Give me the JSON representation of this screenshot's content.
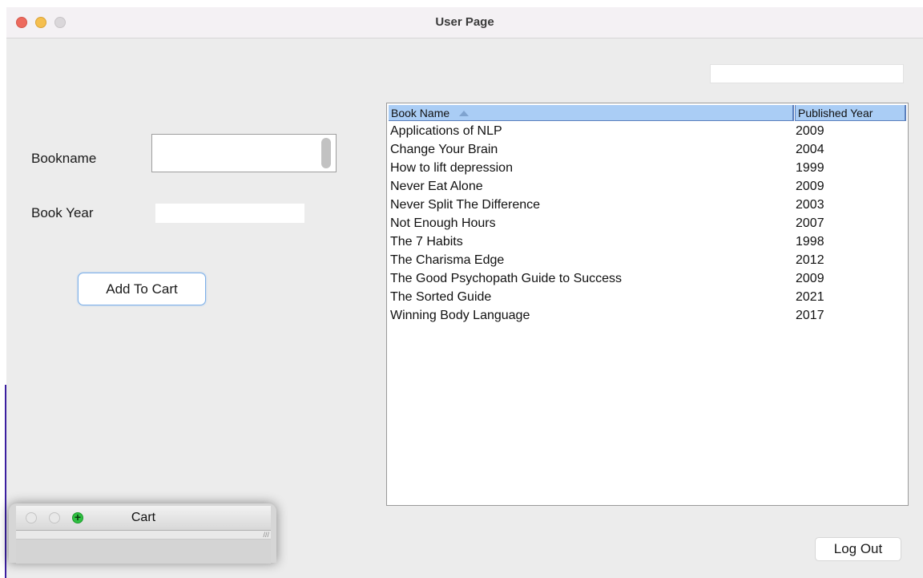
{
  "window": {
    "title": "User Page"
  },
  "form": {
    "bookname_label": "Bookname",
    "bookyear_label": "Book Year",
    "bookname_value": "",
    "bookyear_value": "",
    "add_button_label": "Add To Cart"
  },
  "search": {
    "value": ""
  },
  "table": {
    "columns": [
      "Book Name",
      "Published Year"
    ],
    "sort": {
      "column": "Book Name",
      "direction": "ascending"
    },
    "rows": [
      [
        "Applications of NLP",
        "2009"
      ],
      [
        "Change Your Brain",
        "2004"
      ],
      [
        "How to lift depression",
        "1999"
      ],
      [
        "Never Eat Alone",
        "2009"
      ],
      [
        "Never Split The Difference",
        "2003"
      ],
      [
        "Not Enough Hours",
        "2007"
      ],
      [
        "The 7 Habits",
        "1998"
      ],
      [
        "The Charisma Edge",
        "2012"
      ],
      [
        "The Good Psychopath Guide to Success",
        "2009"
      ],
      [
        "The Sorted Guide",
        "2021"
      ],
      [
        "Winning Body Language",
        "2017"
      ]
    ]
  },
  "logout": {
    "label": "Log Out"
  },
  "cart_window": {
    "title": "Cart",
    "zoom_symbol": "+"
  },
  "icons": [
    "close-icon",
    "minimize-icon",
    "maximize-icon",
    "sort-ascending-icon",
    "resize-grip-icon"
  ],
  "colors": {
    "close": "#ed6a5e",
    "minimize": "#f5bf4f",
    "header_bg": "#aacdf5",
    "button_border": "#7eb0e8",
    "cart_zoom": "#2fc042"
  }
}
